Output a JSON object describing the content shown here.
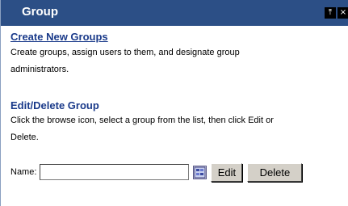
{
  "header": {
    "title": "Group",
    "icons": [
      "pin-icon",
      "close-icon"
    ],
    "pin_glyph": "⤒",
    "close_glyph": "×"
  },
  "create_section": {
    "link_label": "Create New Groups",
    "description_line1": "Create groups, assign users to them, and designate group",
    "description_line2": "administrators."
  },
  "edit_section": {
    "title": "Edit/Delete Group",
    "description_line1": "Click the browse icon, select a group from the list, then click Edit or",
    "description_line2": "Delete."
  },
  "form": {
    "name_label": "Name:",
    "name_value": "",
    "browse_icon": "browse-list-icon",
    "edit_label": "Edit",
    "delete_label": "Delete"
  },
  "colors": {
    "titlebar": "#2c4f86",
    "link": "#1a3a8a",
    "button_face": "#d4d0c8"
  }
}
